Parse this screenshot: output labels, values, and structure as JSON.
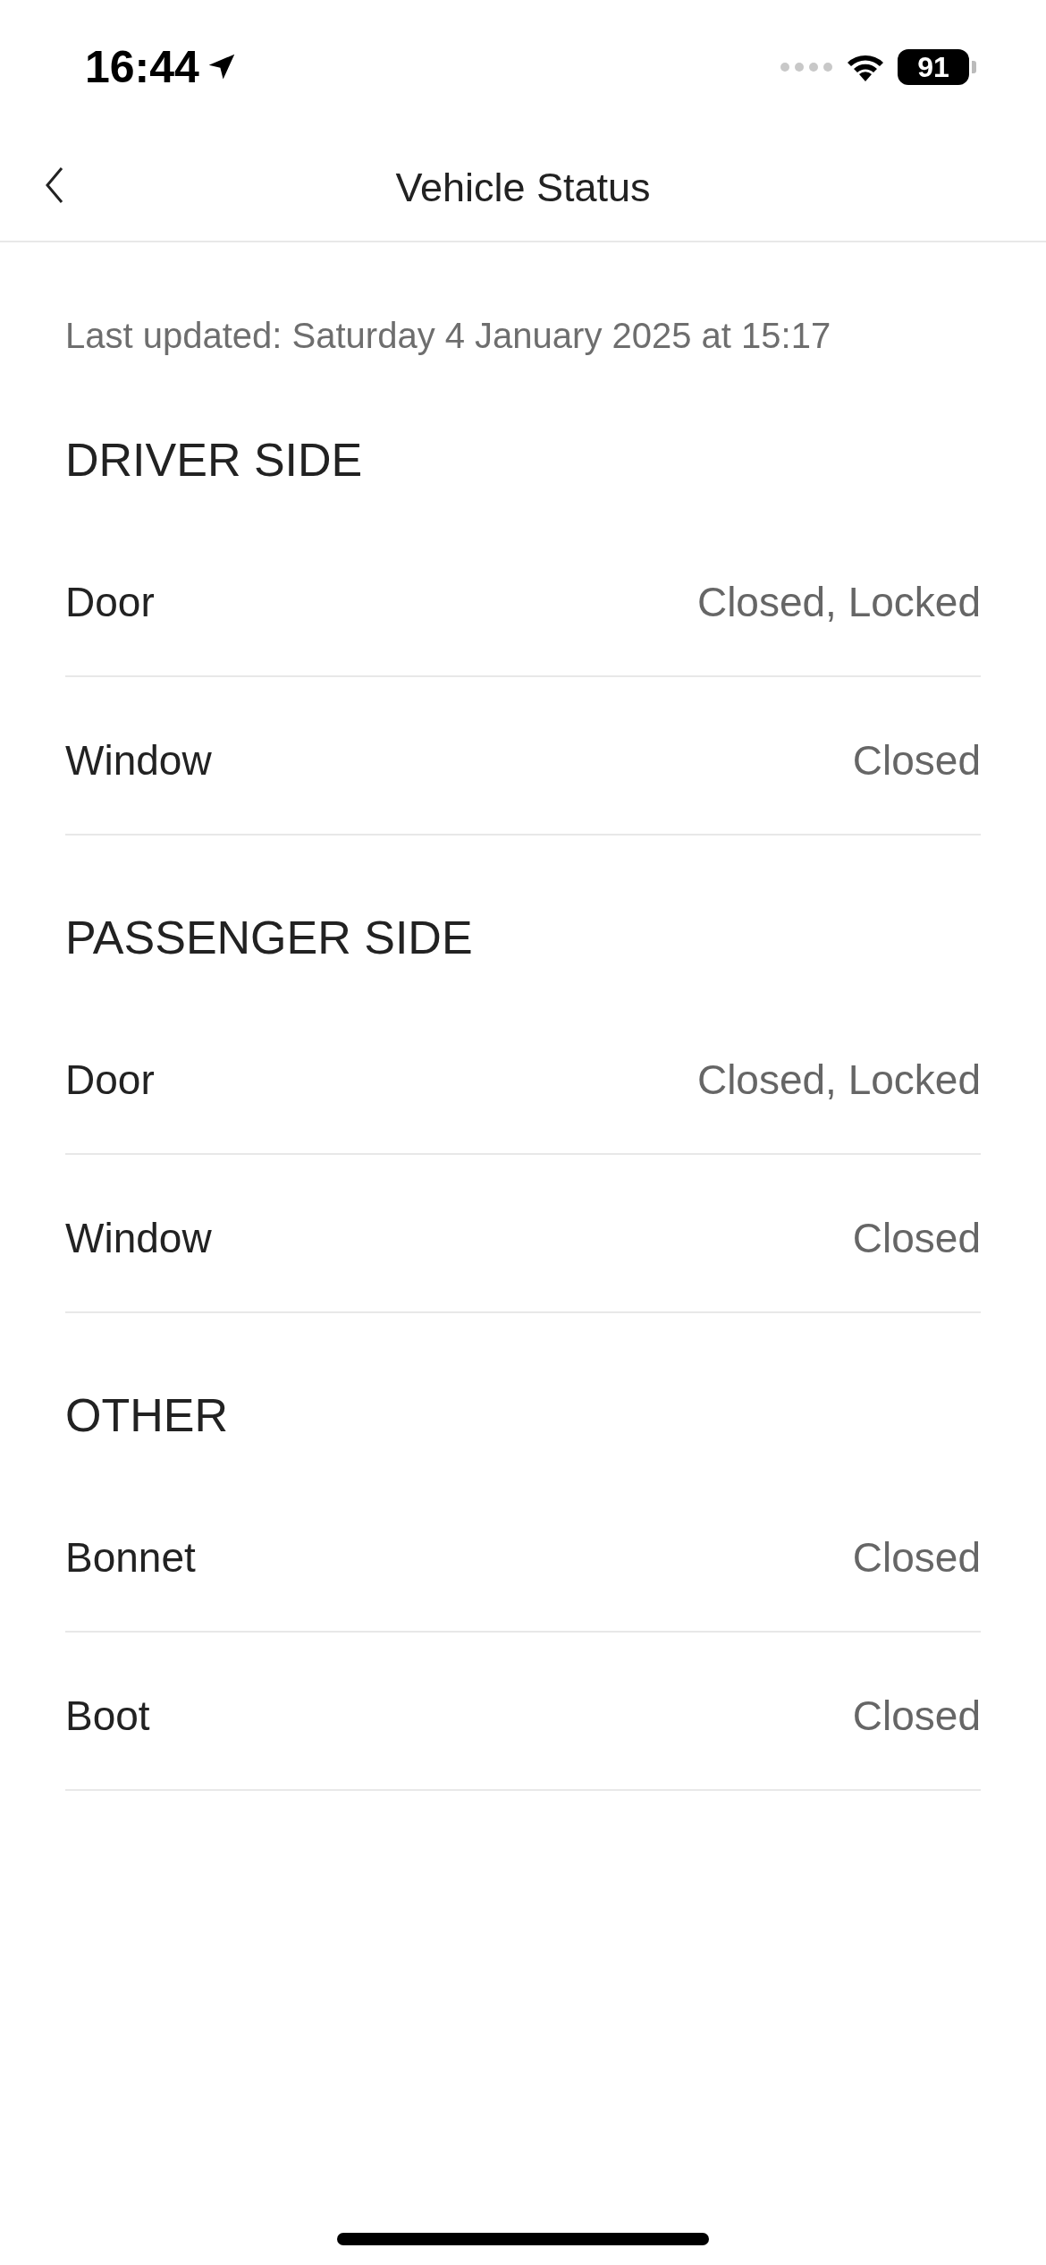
{
  "status_bar": {
    "time": "16:44",
    "battery": "91"
  },
  "nav": {
    "title": "Vehicle Status"
  },
  "last_updated": "Last updated: Saturday 4 January 2025 at 15:17",
  "sections": [
    {
      "title": "DRIVER SIDE",
      "rows": [
        {
          "label": "Door",
          "value": "Closed, Locked"
        },
        {
          "label": "Window",
          "value": "Closed"
        }
      ]
    },
    {
      "title": "PASSENGER SIDE",
      "rows": [
        {
          "label": "Door",
          "value": "Closed, Locked"
        },
        {
          "label": "Window",
          "value": "Closed"
        }
      ]
    },
    {
      "title": "OTHER",
      "rows": [
        {
          "label": "Bonnet",
          "value": "Closed"
        },
        {
          "label": "Boot",
          "value": "Closed"
        }
      ]
    }
  ]
}
